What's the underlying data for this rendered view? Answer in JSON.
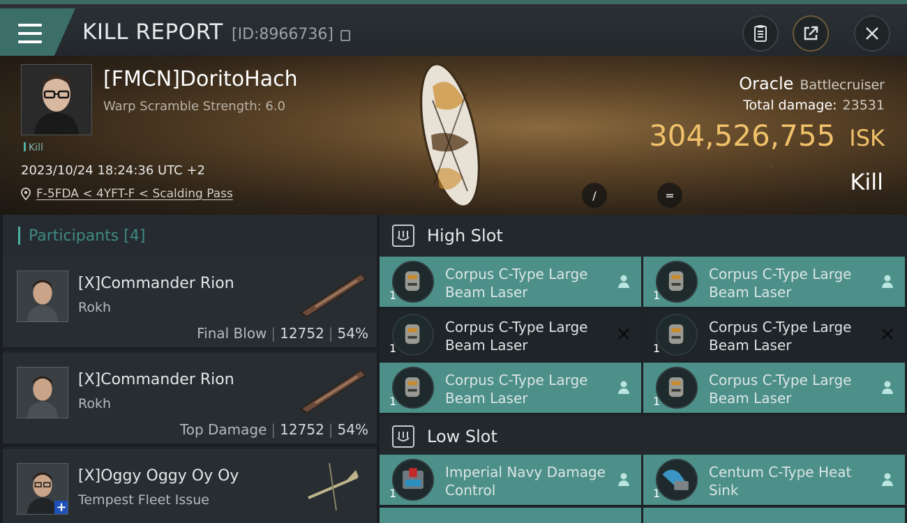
{
  "header": {
    "title": "KILL REPORT",
    "report_id": "[ID:8966736]"
  },
  "victim": {
    "name": "[FMCN]DoritoHach",
    "warp_scramble": "Warp Scramble Strength: 6.0",
    "tag": "Kill",
    "timestamp": "2023/10/24 18:24:36 UTC +2",
    "location": "F-5FDA < 4YFT-F < Scalding Pass"
  },
  "ship": {
    "name": "Oracle",
    "class": "Battlecruiser",
    "total_damage_label": "Total damage:",
    "total_damage": "23531",
    "isk_value": "304,526,755",
    "isk_unit": "ISK",
    "result": "Kill"
  },
  "round_buttons": {
    "b1": "/",
    "b2": "="
  },
  "participants": {
    "label": "Participants",
    "count": "[4]",
    "items": [
      {
        "name": "[X]Commander Rion",
        "ship": "Rokh",
        "role": "Final Blow",
        "damage": "12752",
        "percent": "54%"
      },
      {
        "name": "[X]Commander Rion",
        "ship": "Rokh",
        "role": "Top Damage",
        "damage": "12752",
        "percent": "54%"
      },
      {
        "name": "[X]Oggy Oggy Oy Oy",
        "ship": "Tempest Fleet Issue"
      }
    ]
  },
  "fittings": {
    "high_slot_label": "High Slot",
    "low_slot_label": "Low Slot",
    "high_slot": [
      {
        "name": "Corpus C-Type Large Beam Laser",
        "qty": "1",
        "status": "dropped"
      },
      {
        "name": "Corpus C-Type Large Beam Laser",
        "qty": "1",
        "status": "dropped"
      },
      {
        "name": "Corpus C-Type Large Beam Laser",
        "qty": "1",
        "status": "destroyed"
      },
      {
        "name": "Corpus C-Type Large Beam Laser",
        "qty": "1",
        "status": "destroyed"
      },
      {
        "name": "Corpus C-Type Large Beam Laser",
        "qty": "1",
        "status": "dropped"
      },
      {
        "name": "Corpus C-Type Large Beam Laser",
        "qty": "1",
        "status": "dropped"
      }
    ],
    "low_slot": [
      {
        "name": "Imperial Navy Damage Control",
        "qty": "1",
        "status": "dropped"
      },
      {
        "name": "Centum C-Type Heat Sink",
        "qty": "1",
        "status": "dropped"
      }
    ]
  },
  "icons": {
    "menu": "menu-icon",
    "copy": "copy-icon",
    "clipboard": "clipboard-icon",
    "share": "share-icon",
    "close": "close-icon",
    "location": "location-pin-icon",
    "slot": "turret-slot-icon",
    "dropped": "person-icon",
    "destroyed": "x-mark-icon"
  },
  "colors": {
    "accent": "#4fb0a4",
    "isk": "#f0c16a",
    "module_dropped": "#4d8f89",
    "module_destroyed": "#1e2428"
  }
}
